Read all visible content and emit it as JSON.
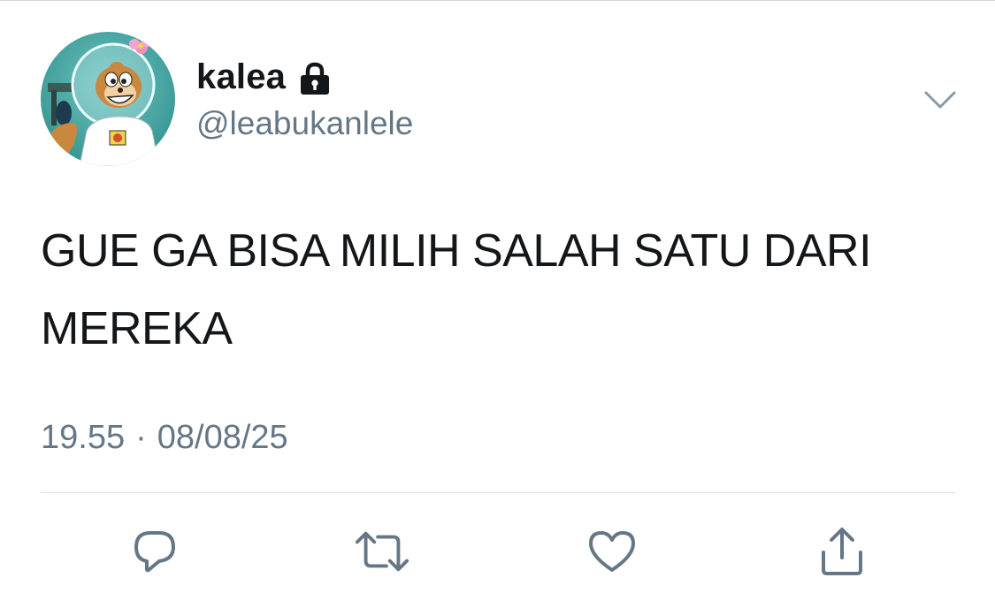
{
  "user": {
    "display_name": "kalea",
    "handle": "@leabukanlele",
    "protected_icon": "lock-icon",
    "avatar_icon": "avatar-image"
  },
  "tweet": {
    "text": "GUE GA BISA MILIH SALAH SATU DARI MEREKA",
    "time": "19.55",
    "separator": "·",
    "date": "08/08/25"
  },
  "menu": {
    "icon": "chevron-down-icon"
  },
  "actions": [
    {
      "name": "reply",
      "icon": "reply-icon"
    },
    {
      "name": "retweet",
      "icon": "retweet-icon"
    },
    {
      "name": "like",
      "icon": "heart-icon"
    },
    {
      "name": "share",
      "icon": "share-icon"
    }
  ],
  "colors": {
    "text_primary": "#14171a",
    "text_secondary": "#657786",
    "icon_gray": "#657786",
    "divider": "#d9dde1"
  }
}
